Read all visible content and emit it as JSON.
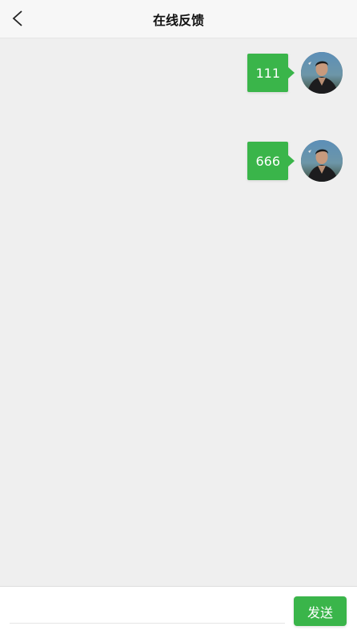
{
  "header": {
    "title": "在线反馈",
    "back_icon": "chevron-left-icon"
  },
  "messages": [
    {
      "text": "111",
      "sender": "me"
    },
    {
      "text": "666",
      "sender": "me"
    }
  ],
  "input_bar": {
    "placeholder": "",
    "value": "",
    "send_label": "发送"
  },
  "colors": {
    "accent": "#3ab54a",
    "background": "#efefef",
    "header_bg": "#f7f7f7"
  }
}
